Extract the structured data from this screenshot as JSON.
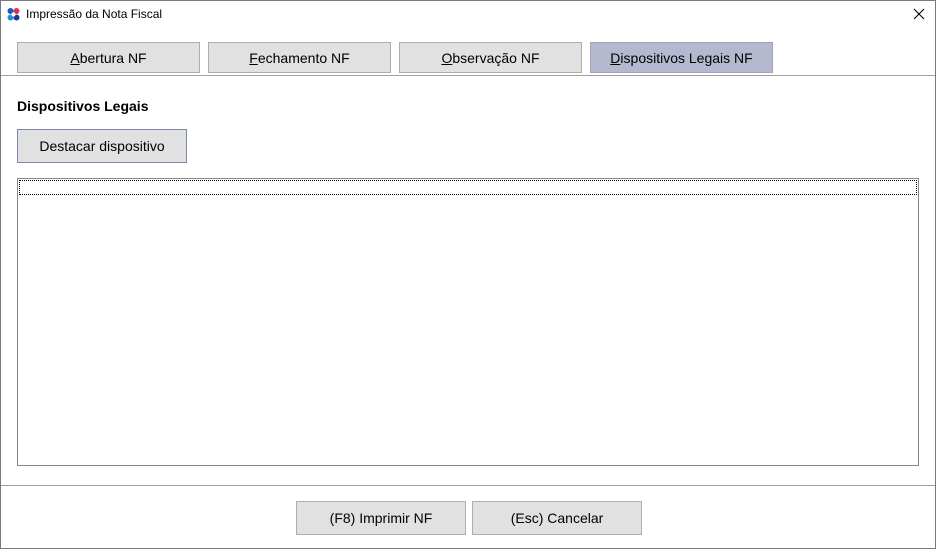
{
  "window": {
    "title": "Impressão da Nota Fiscal"
  },
  "tabs": [
    {
      "label_mnemonic": "A",
      "label_rest": "bertura NF",
      "active": false
    },
    {
      "label_mnemonic": "F",
      "label_rest": "echamento NF",
      "active": false
    },
    {
      "label_mnemonic": "O",
      "label_rest": "bservação NF",
      "active": false
    },
    {
      "label_mnemonic": "D",
      "label_rest": "ispositivos Legais NF",
      "active": true
    }
  ],
  "content": {
    "section_title": "Dispositivos Legais",
    "destacar_label": "Destacar dispositivo",
    "list_items": []
  },
  "footer": {
    "print_label": "(F8) Imprimir NF",
    "cancel_label": "(Esc) Cancelar"
  },
  "colors": {
    "active_tab": "#b4b9d0",
    "button_bg": "#e1e1e1"
  },
  "icons": {
    "app": "app-logo-icon",
    "close": "close-icon"
  }
}
